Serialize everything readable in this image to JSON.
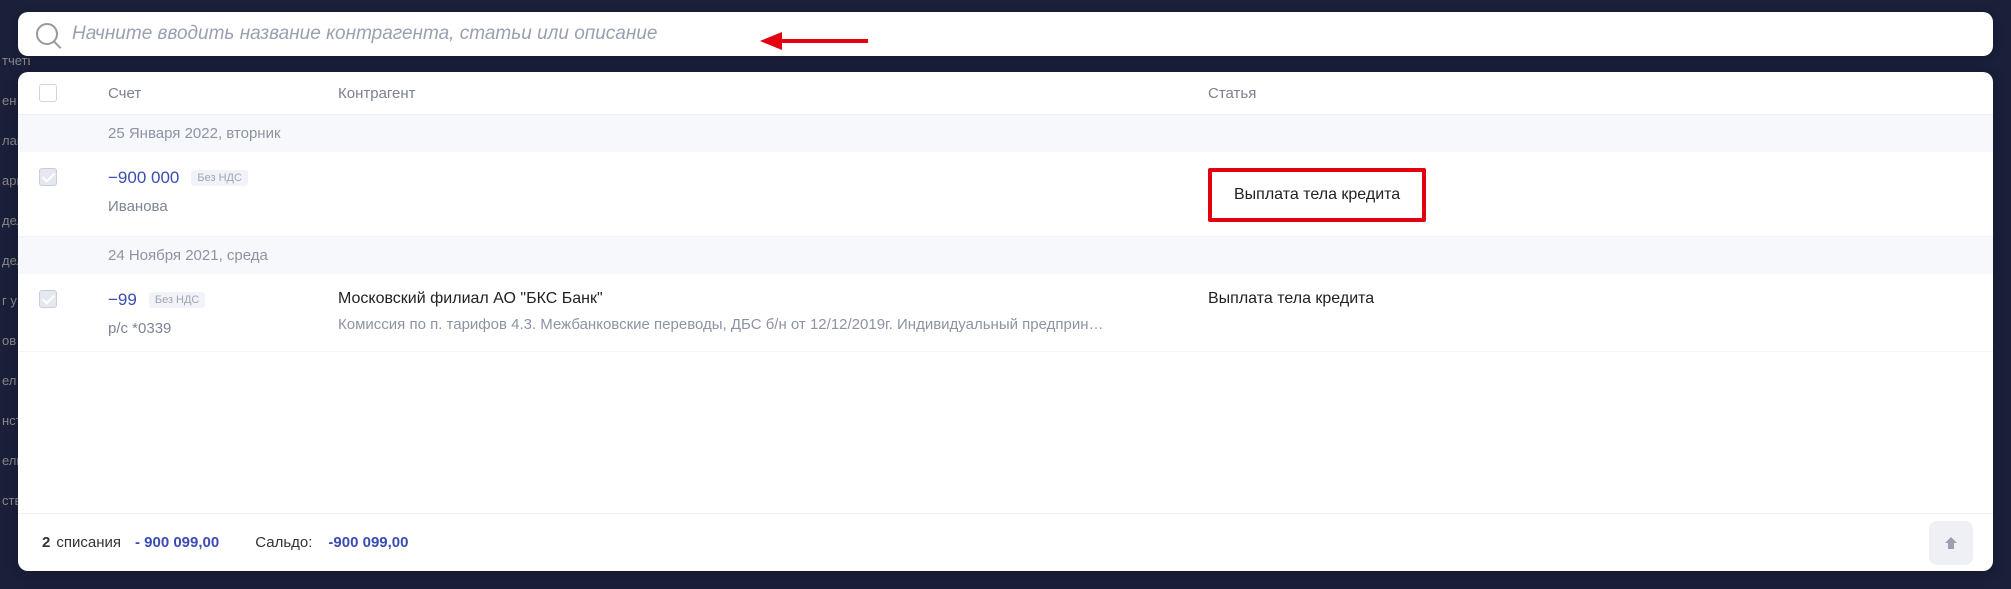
{
  "search": {
    "placeholder": "Начните вводить название контрагента, статьи или описание"
  },
  "columns": {
    "account": "Счет",
    "counterparty": "Контрагент",
    "article": "Статья"
  },
  "groups": [
    {
      "date_label": "25 Января 2022, вторник",
      "rows": [
        {
          "checked": true,
          "amount": "−900 000",
          "vat_badge": "Без НДС",
          "subaccount": "Иванова",
          "counterparty_name": "",
          "counterparty_desc": "",
          "article": "Выплата тела кредита",
          "highlighted": true
        }
      ]
    },
    {
      "date_label": "24 Ноября 2021, среда",
      "rows": [
        {
          "checked": true,
          "amount": "−99",
          "vat_badge": "Без НДС",
          "subaccount": "р/с *0339",
          "counterparty_name": "Московский филиал АО \"БКС Банк\"",
          "counterparty_desc": "Комиссия по п. тарифов 4.3. Межбанковские переводы, ДБС б/н от 12/12/2019г. Индивидуальный предприн…",
          "article": "Выплата тела кредита",
          "highlighted": false
        }
      ]
    }
  ],
  "footer": {
    "count_n": "2",
    "count_label": "списания",
    "total_writeoff": "- 900 099,00",
    "balance_label": "Сальдо:",
    "balance_value": "-900 099,00"
  },
  "bg_nav": [
    "тчеты",
    "ен",
    "лан",
    "арг",
    "дел",
    "дел",
    "г у",
    "ов",
    "ел",
    "нст",
    "ель",
    "ство"
  ]
}
